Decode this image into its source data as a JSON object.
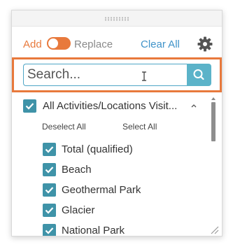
{
  "toolbar": {
    "add_label": "Add",
    "replace_label": "Replace",
    "clear_all_label": "Clear All",
    "mode_toggle_state": "Add"
  },
  "search": {
    "placeholder": "Search...",
    "value": ""
  },
  "filter": {
    "parent_label": "All Activities/Locations Visit...",
    "deselect_all_label": "Deselect All",
    "select_all_label": "Select All",
    "items": [
      {
        "label": "Total (qualified)",
        "checked": true
      },
      {
        "label": "Beach",
        "checked": true
      },
      {
        "label": "Geothermal Park",
        "checked": true
      },
      {
        "label": "Glacier",
        "checked": true
      },
      {
        "label": "National Park",
        "checked": true
      }
    ]
  },
  "icons": {
    "settings": "gear-icon",
    "search": "search-icon",
    "collapse": "chevron-up-icon",
    "resize": "resize-grip-icon"
  },
  "colors": {
    "accent_orange": "#e8793c",
    "link_blue": "#3f93c9",
    "checkbox_teal": "#3f93a8",
    "search_button": "#5bb3c9",
    "search_border": "#4fa6c6"
  }
}
